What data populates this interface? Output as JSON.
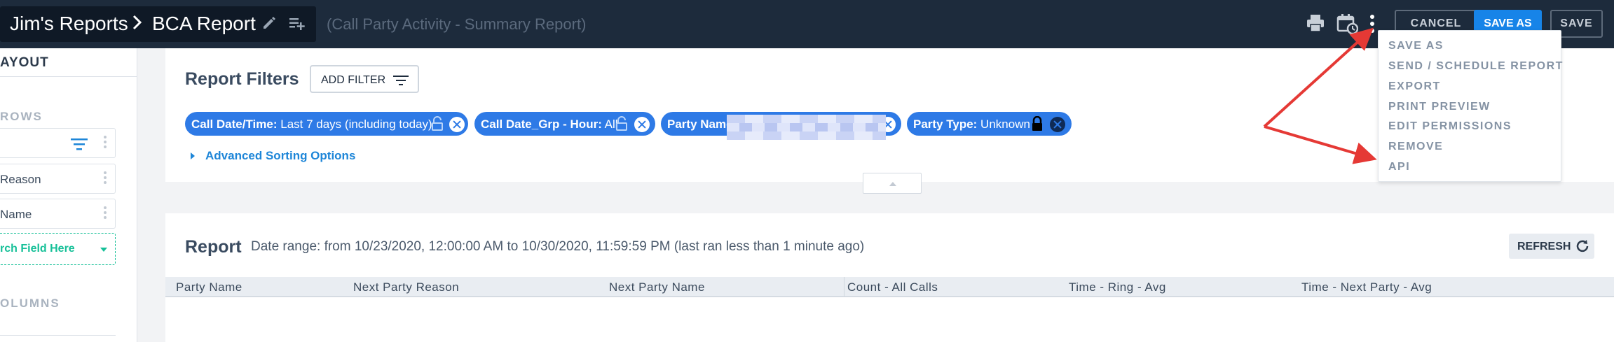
{
  "header": {
    "breadcrumb_parent": "Jim's Reports",
    "breadcrumb_current": "BCA Report",
    "report_type": "(Call Party Activity - Summary Report)",
    "cancel_label": "CANCEL",
    "save_as_label": "SAVE AS",
    "save_label": "SAVE",
    "icons": [
      "edit-pencil-icon",
      "add-to-list-icon",
      "print-icon",
      "schedule-calendar-icon",
      "more-vertical-icon"
    ]
  },
  "sidebar": {
    "title": "AYOUT",
    "rows_heading": "ROWS",
    "rows": [
      {
        "label": ""
      },
      {
        "label": "Reason"
      },
      {
        "label": "Name"
      }
    ],
    "search_field": "rch Field Here",
    "columns_heading": "OLUMNS"
  },
  "filters": {
    "title": "Report Filters",
    "add_filter_label": "ADD FILTER",
    "chips": [
      {
        "field": "Call Date/Time:",
        "value": " Last 7 days (including today)",
        "locked": false
      },
      {
        "field": "Call Date_Grp - Hour:",
        "value": " All",
        "locked": false
      },
      {
        "field": "Party Name",
        "value": "",
        "locked": false
      },
      {
        "field": "Party Type:",
        "value": " Unknown",
        "locked": true
      }
    ],
    "advanced_sorting_label": "Advanced Sorting Options"
  },
  "report": {
    "title": "Report",
    "date_range": "Date range: from 10/23/2020, 12:00:00 AM to 10/30/2020, 11:59:59 PM (last ran less than 1 minute ago)",
    "refresh_label": "REFRESH",
    "columns": [
      "Party Name",
      "Next Party Reason",
      "Next Party Name",
      "Count - All Calls",
      "Time - Ring - Avg",
      "Time - Next Party - Avg"
    ]
  },
  "menu": {
    "items": [
      "SAVE AS",
      "SEND / SCHEDULE REPORT",
      "EXPORT",
      "PRINT PREVIEW",
      "EDIT PERMISSIONS",
      "REMOVE",
      "API"
    ]
  },
  "colors": {
    "topbar": "#1d2b3c",
    "accent_blue": "#1784e8",
    "chip_blue": "#2e7ae6",
    "annotation_red": "#e53935",
    "search_green": "#16c098"
  }
}
